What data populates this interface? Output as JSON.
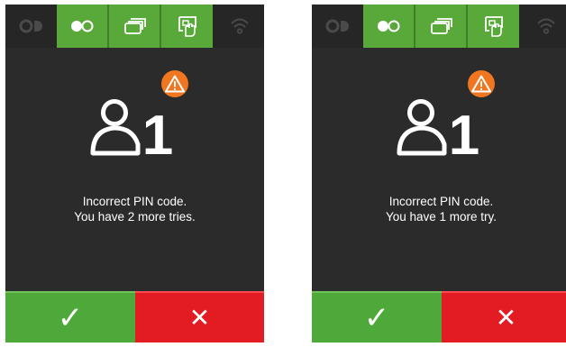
{
  "colors": {
    "screen_background": "#2b2b2b",
    "status_active_green": "#58a83a",
    "confirm_green": "#4ea93a",
    "cancel_red": "#e31b23",
    "warning_orange": "#f0771f",
    "dim_icon_gray": "#4a4a4a"
  },
  "status_bar_icons": [
    "contactless-logo-icon",
    "magstripe-card-icon",
    "card-stack-icon",
    "chip-card-insert-icon",
    "wifi-signal-icon"
  ],
  "screens": [
    {
      "user_number": "1",
      "message_line1": "Incorrect PIN code.",
      "message_line2": "You have 2 more tries.",
      "confirm_glyph": "✓",
      "cancel_glyph": "✕"
    },
    {
      "user_number": "1",
      "message_line1": "Incorrect PIN code.",
      "message_line2": "You have 1 more try.",
      "confirm_glyph": "✓",
      "cancel_glyph": "✕"
    }
  ]
}
